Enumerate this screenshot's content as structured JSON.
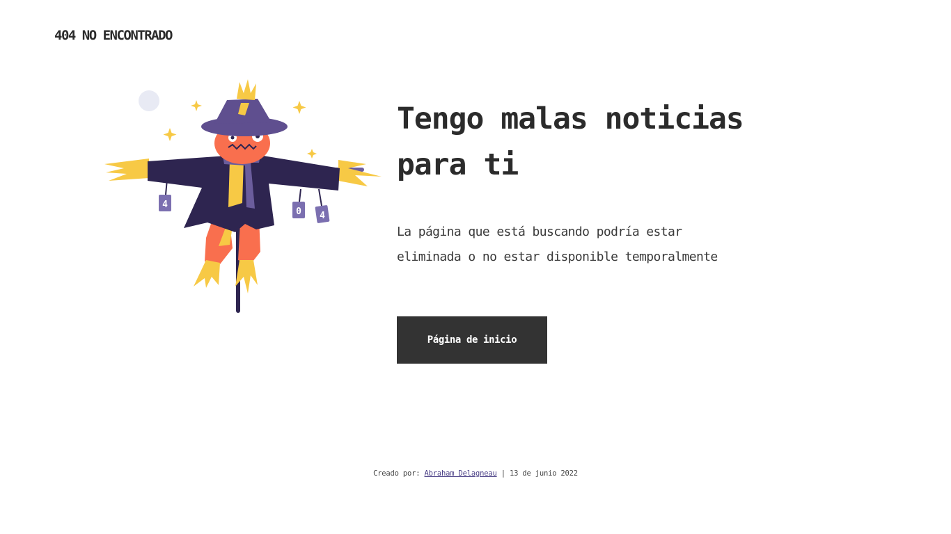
{
  "header": {
    "brand": "404 NO ENCONTRADO"
  },
  "illustration": {
    "name": "scarecrow-illustration",
    "can_labels": [
      "4",
      "0",
      "4"
    ],
    "colors": {
      "hat": "#5f4f8f",
      "coat": "#2e2550",
      "face": "#f96f4e",
      "straw": "#f7c945",
      "scarf": "#6b5d9c",
      "moon": "#e8eaf4"
    }
  },
  "main": {
    "headline_line1": "Tengo malas noticias",
    "headline_line2": "para ti",
    "description": "La página que está buscando podría estar eliminada o no estar disponible temporalmente",
    "home_button_label": "Página de inicio"
  },
  "footer": {
    "prefix": "Creado por: ",
    "author_link": "Abraham Delagneau",
    "suffix": " | 13 de junio 2022"
  },
  "colors": {
    "button_bg": "#333333",
    "text": "#2b2b2b",
    "link": "#4a3f86"
  }
}
